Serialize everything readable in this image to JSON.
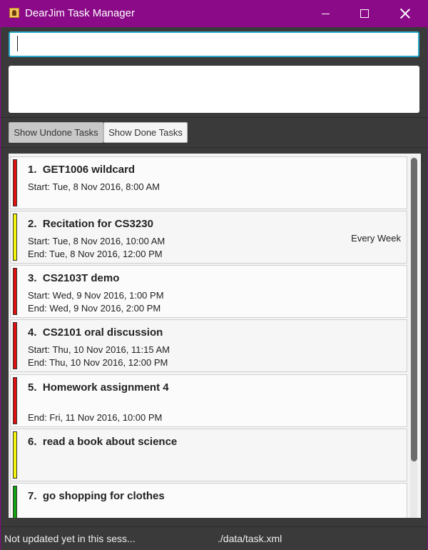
{
  "window": {
    "title": "DearJim Task Manager",
    "title_bar_color": "#8a0a88",
    "controls": [
      "minimize-icon",
      "maximize-icon",
      "close-icon"
    ]
  },
  "command": {
    "value": "",
    "placeholder": ""
  },
  "result": {
    "text": ""
  },
  "toggle": {
    "undone_label": "Show Undone Tasks",
    "done_label": "Show Done Tasks",
    "selected": "undone"
  },
  "tasks": [
    {
      "index": "1.",
      "name": "GET1006 wildcard",
      "line1": "Start: Tue, 8 Nov 2016, 8:00 AM",
      "line2": "",
      "recurrence": "",
      "priority_color": "#e01010"
    },
    {
      "index": "2.",
      "name": "Recitation for CS3230",
      "line1": "Start: Tue, 8 Nov 2016, 10:00 AM",
      "line2": "End: Tue, 8 Nov 2016, 12:00 PM",
      "recurrence": "Every Week",
      "priority_color": "#f5f50a"
    },
    {
      "index": "3.",
      "name": "CS2103T demo",
      "line1": "Start: Wed, 9 Nov 2016, 1:00 PM",
      "line2": "End: Wed, 9 Nov 2016, 2:00 PM",
      "recurrence": "",
      "priority_color": "#e01010"
    },
    {
      "index": "4.",
      "name": "CS2101 oral discussion",
      "line1": "Start: Thu, 10 Nov 2016, 11:15 AM",
      "line2": "End: Thu, 10 Nov 2016, 12:00 PM",
      "recurrence": "",
      "priority_color": "#e01010"
    },
    {
      "index": "5.",
      "name": "Homework assignment 4",
      "line1": "",
      "line2": "End: Fri, 11 Nov 2016, 10:00 PM",
      "recurrence": "",
      "priority_color": "#e01010"
    },
    {
      "index": "6.",
      "name": "read a book about science",
      "line1": "",
      "line2": "",
      "recurrence": "",
      "priority_color": "#f5f50a"
    },
    {
      "index": "7.",
      "name": "go shopping for clothes",
      "line1": "",
      "line2": "",
      "recurrence": "",
      "priority_color": "#13a013"
    }
  ],
  "status": {
    "sync": "Not updated yet in this sess...",
    "file": "./data/task.xml"
  }
}
